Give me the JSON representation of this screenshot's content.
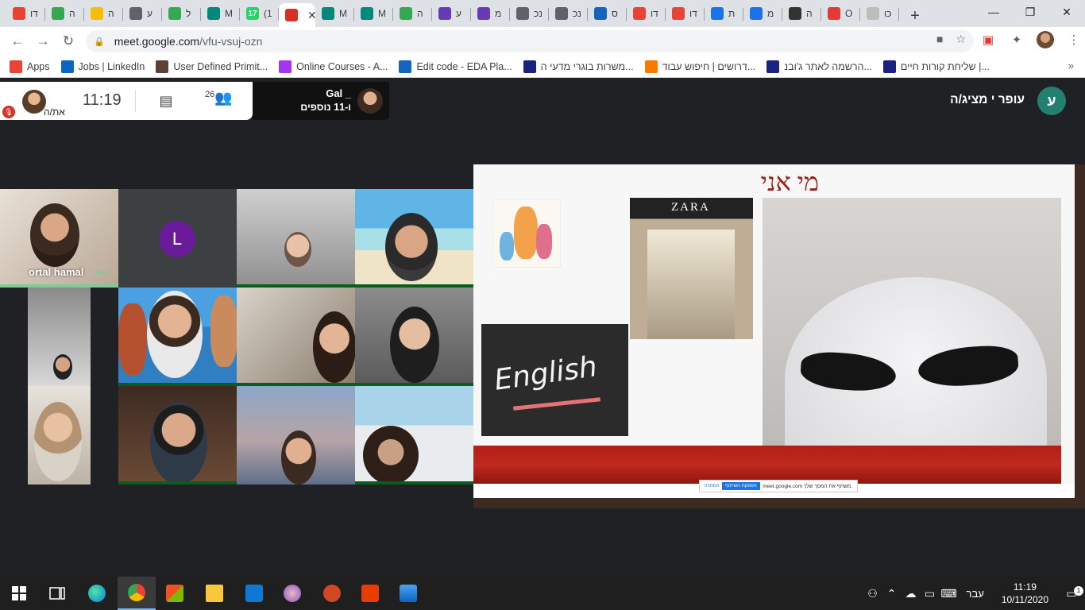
{
  "browser": {
    "tabs": [
      {
        "label": "דו",
        "icon": "gmail-icon",
        "color": "#ea4335"
      },
      {
        "label": "ה",
        "icon": "drive-icon",
        "color": "#34a853"
      },
      {
        "label": "ה",
        "icon": "drive-icon",
        "color": "#fbbc04"
      },
      {
        "label": "ע",
        "icon": "classroom-icon",
        "color": "#5f6368"
      },
      {
        "label": "ל",
        "icon": "drive-icon",
        "color": "#34a853"
      },
      {
        "label": "M",
        "icon": "meet-icon",
        "color": "#00897b"
      },
      {
        "label": "(1",
        "icon": "whatsapp-icon",
        "color": "#25d366",
        "badge": "17"
      },
      {
        "label": "",
        "icon": "recording-icon",
        "color": "#d93025",
        "active": true
      },
      {
        "label": "M",
        "icon": "meet-icon",
        "color": "#00897b"
      },
      {
        "label": "M",
        "icon": "meet-icon",
        "color": "#00897b"
      },
      {
        "label": "ה",
        "icon": "drive-icon",
        "color": "#34a853"
      },
      {
        "label": "ע",
        "icon": "forms-icon",
        "color": "#673ab7"
      },
      {
        "label": "מ",
        "icon": "forms-icon",
        "color": "#673ab7"
      },
      {
        "label": "נכ",
        "icon": "globe-icon",
        "color": "#5f6368"
      },
      {
        "label": "נכ",
        "icon": "globe-icon",
        "color": "#5f6368"
      },
      {
        "label": "ס",
        "icon": "s-icon",
        "color": "#1565c0"
      },
      {
        "label": "דו",
        "icon": "gmail-icon",
        "color": "#ea4335"
      },
      {
        "label": "דו",
        "icon": "gmail-icon",
        "color": "#ea4335"
      },
      {
        "label": "ת",
        "icon": "contacts-icon",
        "color": "#1a73e8"
      },
      {
        "label": "מ",
        "icon": "chat-icon",
        "color": "#1a73e8"
      },
      {
        "label": "ה",
        "icon": "calendar-icon",
        "color": "#333333"
      },
      {
        "label": "O",
        "icon": "s-red-icon",
        "color": "#e53935"
      },
      {
        "label": "כו",
        "icon": "doc-icon",
        "color": "#bdbdbd"
      }
    ],
    "new_tab": "+",
    "window": {
      "minimize": "—",
      "restore": "❐",
      "close": "✕"
    },
    "url_host": "meet.google.com",
    "url_path": "/vfu-vsuj-ozn",
    "bookmarks": [
      {
        "label": "Apps",
        "icon": "apps-icon",
        "color": "#ea4335"
      },
      {
        "label": "Jobs | LinkedIn",
        "icon": "linkedin-icon",
        "color": "#0a66c2"
      },
      {
        "label": "User Defined Primit...",
        "icon": "bookmark-icon",
        "color": "#5d4037"
      },
      {
        "label": "Online Courses - A...",
        "icon": "udemy-icon",
        "color": "#a435f0"
      },
      {
        "label": "Edit code - EDA Pla...",
        "icon": "eda-icon",
        "color": "#1565c0"
      },
      {
        "label": "משרות בוגרי מדעי ה...",
        "icon": "ji-icon",
        "color": "#1a237e"
      },
      {
        "label": "דרושים | חיפוש עבוד...",
        "icon": "orange-t-icon",
        "color": "#f57c00"
      },
      {
        "label": "הרשמה לאתר ג'ובנ...",
        "icon": "ji-icon",
        "color": "#1a237e"
      },
      {
        "label": "שליחת קורות חיים |...",
        "icon": "ji-icon",
        "color": "#1a237e"
      }
    ],
    "bookmarks_more": "»"
  },
  "meet": {
    "self_label": "את/ה",
    "clock": "11:19",
    "people_count": "26",
    "presenting_name": "Gal _",
    "presenting_more": "ו-11 נוספים",
    "presenter_label": "עופר י מציג/ה",
    "presenter_initial": "ע",
    "tiles": {
      "ortal_name": "ortal hamal",
      "ortal_dots": "•••",
      "letter_initial": "L"
    },
    "slide": {
      "title": "מי אני",
      "zara_sign": "ZARA",
      "english_word": "English",
      "share_text": "meet.google.com משתף את המסך שלך.",
      "share_stop": "הפסקת השיתוף",
      "share_hide": "הסתרה"
    }
  },
  "taskbar": {
    "language": "עבר",
    "time": "11:19",
    "date": "10/11/2020",
    "notifications": "1"
  },
  "colors": {
    "meet_bg": "#202124",
    "slide_title": "#9b1c12",
    "slide_band": "#c12a1e",
    "presenter_avatar": "#218070",
    "letter_avatar": "#6a1b9a",
    "active_speaker": "#81c995"
  }
}
